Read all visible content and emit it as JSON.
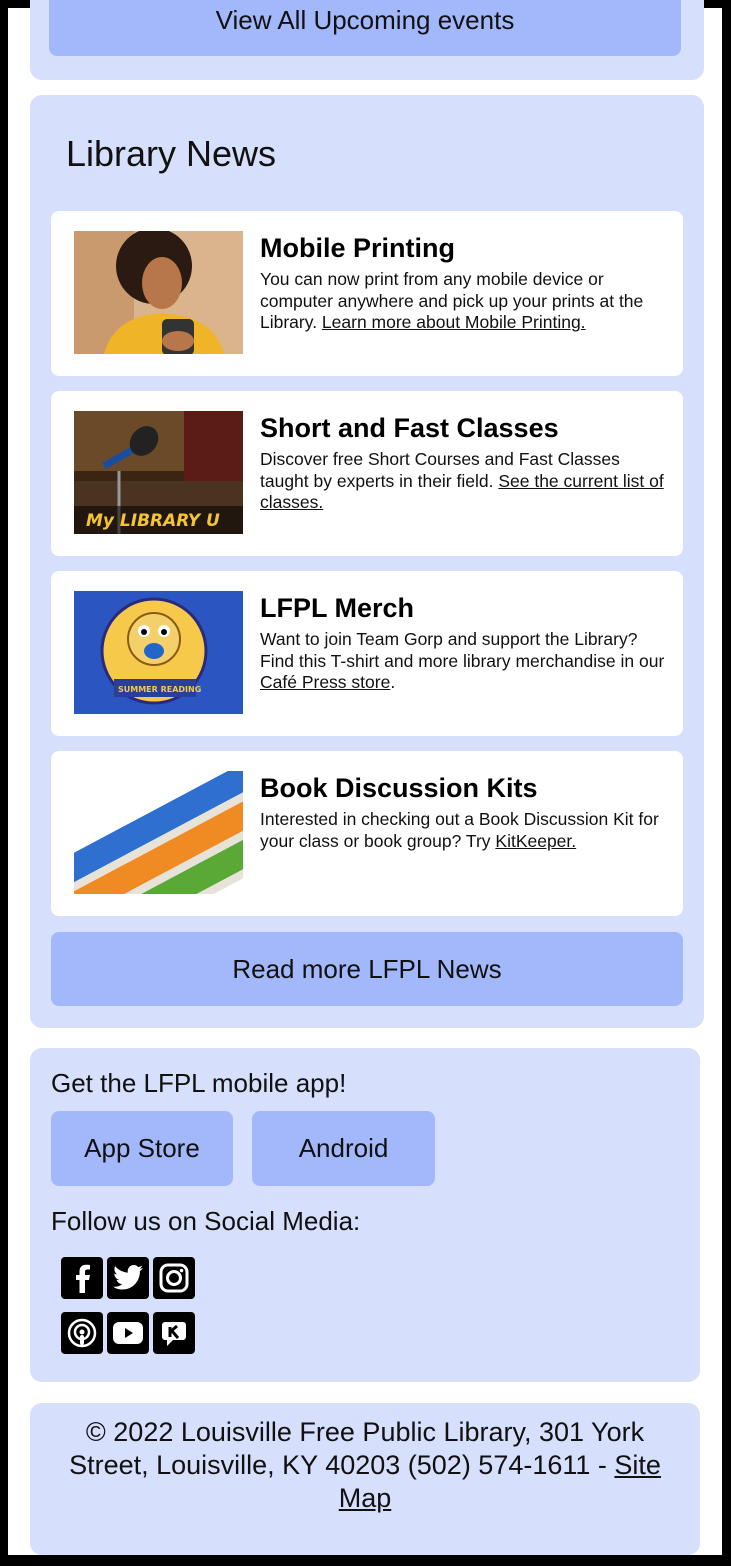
{
  "events": {
    "view_all_label": "View All Upcoming events"
  },
  "news": {
    "heading": "Library News",
    "items": [
      {
        "title": "Mobile Printing",
        "text": "You can now print from any mobile device or computer anywhere and pick up your prints at the Library. ",
        "link": "Learn more about Mobile Printing.",
        "after": ""
      },
      {
        "title": "Short and Fast Classes",
        "text": "Discover free Short Courses and Fast Classes taught by experts in their field. ",
        "link": "See the current list of classes.",
        "after": ""
      },
      {
        "title": "LFPL Merch",
        "text": "Want to join Team Gorp and support the Library? Find this T-shirt and more library merchandise in our ",
        "link": "Café Press store",
        "after": "."
      },
      {
        "title": "Book Discussion Kits",
        "text": "Interested in checking out a Book Discussion Kit for your class or book group? Try ",
        "link": "KitKeeper.",
        "after": ""
      }
    ],
    "thumb_text": {
      "classes_logo": "My LIBRARY U",
      "merch_badge": "SUMMER READING"
    },
    "read_more_label": "Read more LFPL News"
  },
  "app": {
    "heading": "Get the LFPL mobile app!",
    "app_store_label": "App Store",
    "android_label": "Android"
  },
  "social": {
    "heading": "Follow us on Social Media:",
    "icons": [
      "facebook-icon",
      "twitter-icon",
      "instagram-icon",
      "podcast-icon",
      "youtube-icon",
      "kanopy-icon"
    ]
  },
  "footer": {
    "copyright": "© 2022 Louisville Free Public Library, 301 York Street, Louisville, KY 40203 (502) 574-1611 - ",
    "site_map_label": "Site Map"
  },
  "colors": {
    "panel": "#d6dffc",
    "button": "#a3b8fb",
    "card": "#ffffff",
    "frame": "#000000"
  }
}
